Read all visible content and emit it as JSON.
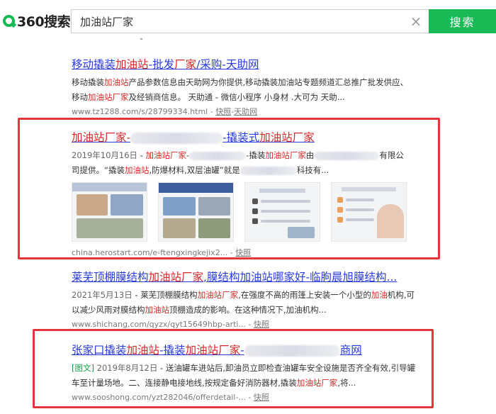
{
  "header": {
    "logo_text": "360搜索",
    "search_value": "加油站厂家",
    "search_button": "搜索",
    "clear_icon": "×"
  },
  "results": [
    {
      "title_parts": [
        "移动撬装",
        "加油站",
        "-批发",
        "厂家",
        "/采购-天助网"
      ],
      "desc_l1": [
        "移动撬装",
        "加油站",
        "产品参数信息由天助网为你提供,移动撬装加油站专题频道汇总推广批发供应、"
      ],
      "desc_l2": [
        "移动",
        "加油站厂家",
        "及经销商信息。 天助通 - 微信小程序 小身材 .大可为 天助..."
      ],
      "url": "www.tz1288.com/s/28799334.html",
      "snapshot": "快照",
      "source": "天助网"
    },
    {
      "title_parts": [
        "加油站厂家",
        "-",
        "-撬装式",
        "加油站厂家"
      ],
      "date": "2019年10月16日",
      "desc_l1": [
        "加油站厂家",
        "-",
        "-撬装",
        "加油站厂家",
        "由",
        "有限公"
      ],
      "desc_l2": [
        "司提供。“撬装",
        "加油站",
        ",防爆材料,双层油罐”就是",
        "科技有..."
      ],
      "url": "china.herostart.com/e-ftengxingkejix2...",
      "snapshot": "快照"
    },
    {
      "title_parts": [
        "莱芜顶棚膜结构",
        "加油站厂家",
        ",膜结构加油站哪家好-临朐晨旭膜结构..."
      ],
      "date": "2021年5月13日",
      "desc_l1": [
        "莱芜顶棚膜结构",
        "加油站厂家",
        ",在强度不高的雨篷上安装一个小型的",
        "加油",
        "机构,可"
      ],
      "desc_l2": [
        "以减少风雨对膜结构",
        "加油站",
        "顶棚造成的影响。在这种情况下,加油机构..."
      ],
      "url": "www.shichang.com/qyzx/qyt15649hbp-arti...",
      "snapshot": "快照"
    },
    {
      "title_parts": [
        "张家口撬装",
        "加油站",
        "-撬装",
        "加油站厂家",
        "-",
        "商网"
      ],
      "tag": "[图文]",
      "date": "2019年8月12日",
      "desc_l1": [
        "送油罐车进站后,卸油员立即检查油罐车安全设施是否齐全有效,引导罐"
      ],
      "desc_l2": [
        "车至计量场地。二、连接静电接地线,按规定备好消防器材,撬装",
        "加油站厂家",
        ",将..."
      ],
      "url": "www.sooshong.com/yzt282046/offerdetail-...",
      "snapshot": "快照"
    }
  ]
}
